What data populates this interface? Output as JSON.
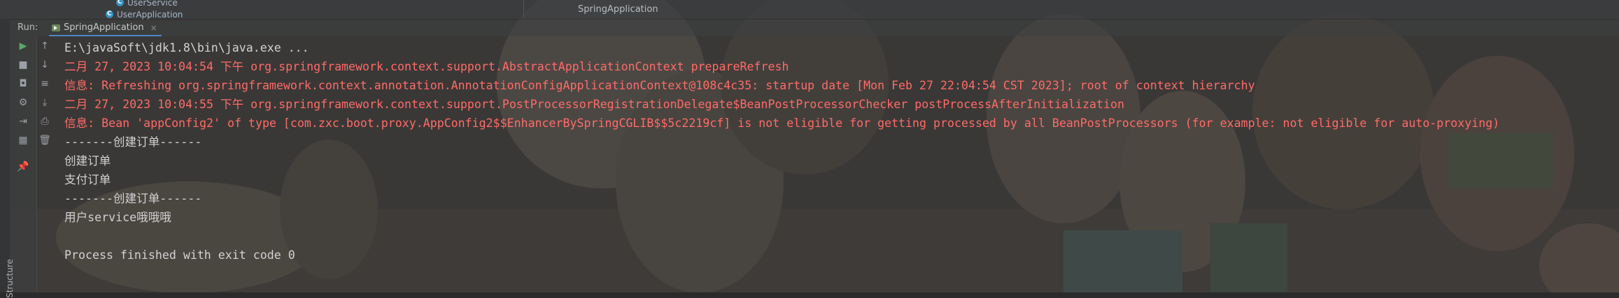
{
  "project_tree": {
    "items": [
      {
        "label": "UserService",
        "icon": "class-icon"
      },
      {
        "label": "UserApplication",
        "icon": "class-icon"
      }
    ]
  },
  "window_title": "SpringApplication",
  "run_panel": {
    "label": "Run:",
    "tab": {
      "label": "SpringApplication",
      "close": "×"
    }
  },
  "toolbar": {
    "buttons": [
      {
        "name": "rerun-button",
        "icon": "play-icon"
      },
      {
        "name": "up-button",
        "icon": "arrow-up-icon"
      },
      {
        "name": "stop-button",
        "icon": "stop-icon"
      },
      {
        "name": "down-button",
        "icon": "arrow-down-icon"
      },
      {
        "name": "screenshot-button",
        "icon": "camera-icon"
      },
      {
        "name": "soft-wrap-button",
        "icon": "wrap-icon"
      },
      {
        "name": "settings-button",
        "icon": "gear-icon"
      },
      {
        "name": "scroll-to-end-button",
        "icon": "scroll-end-icon"
      },
      {
        "name": "exit-button",
        "icon": "exit-icon"
      },
      {
        "name": "print-button",
        "icon": "print-icon"
      },
      {
        "name": "layout-button",
        "icon": "layout-icon"
      },
      {
        "name": "delete-button",
        "icon": "trash-icon"
      },
      {
        "name": "pin-button",
        "icon": "pin-icon"
      }
    ],
    "side_label": "Structure"
  },
  "console": {
    "lines": [
      {
        "text": "E:\\javaSoft\\jdk1.8\\bin\\java.exe ...",
        "type": "normal"
      },
      {
        "text": "二月 27, 2023 10:04:54 下午 org.springframework.context.support.AbstractApplicationContext prepareRefresh",
        "type": "error"
      },
      {
        "text": "信息: Refreshing org.springframework.context.annotation.AnnotationConfigApplicationContext@108c4c35: startup date [Mon Feb 27 22:04:54 CST 2023]; root of context hierarchy",
        "type": "error"
      },
      {
        "text": "二月 27, 2023 10:04:55 下午 org.springframework.context.support.PostProcessorRegistrationDelegate$BeanPostProcessorChecker postProcessAfterInitialization",
        "type": "error"
      },
      {
        "text": "信息: Bean 'appConfig2' of type [com.zxc.boot.proxy.AppConfig2$$EnhancerBySpringCGLIB$$5c2219cf] is not eligible for getting processed by all BeanPostProcessors (for example: not eligible for auto-proxying)",
        "type": "error"
      },
      {
        "text": "-------创建订单------",
        "type": "normal"
      },
      {
        "text": "创建订单",
        "type": "normal"
      },
      {
        "text": "支付订单",
        "type": "normal"
      },
      {
        "text": "-------创建订单------",
        "type": "normal"
      },
      {
        "text": "用户service哦哦哦",
        "type": "normal"
      },
      {
        "text": "",
        "type": "normal"
      },
      {
        "text": "Process finished with exit code 0",
        "type": "normal"
      }
    ]
  },
  "colors": {
    "error": "#ff6b68",
    "normal": "#d2d2d2",
    "background": "#2b2b2b",
    "accent": "#4a88c7"
  }
}
